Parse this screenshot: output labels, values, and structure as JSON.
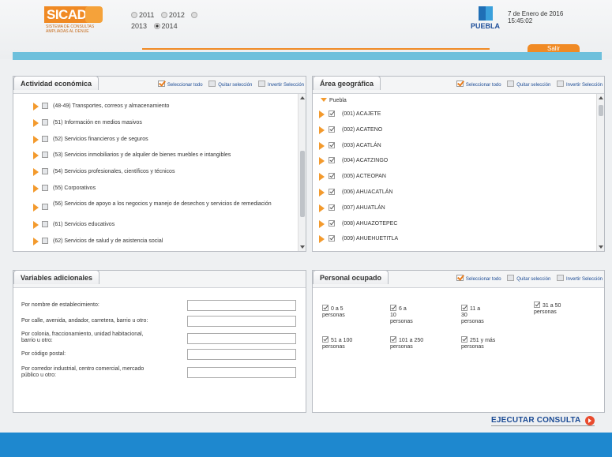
{
  "header": {
    "logo_text": "SICAD",
    "logo_subtitle": "SISTEMA DE CONSULTAS AMPLIADAS AL DENUE",
    "puebla_text": "PUEBLA",
    "date": "7 de Enero de 2016",
    "time": "15:45:02",
    "salir_label": "Salir"
  },
  "years": {
    "options": [
      "2011",
      "2012",
      "",
      "2013",
      "2014"
    ],
    "selected": "2014"
  },
  "actividad": {
    "title": "Actividad económica",
    "select_all": "Seleccionar todo",
    "clear": "Quitar selección",
    "invert": "Invertir Selección",
    "items": [
      "(48-49) Transportes, correos y almacenamiento",
      "(51) Información en medios masivos",
      "(52) Servicios financieros y de seguros",
      "(53) Servicios inmobiliarios y de alquiler de bienes muebles e intangibles",
      "(54) Servicios profesionales, científicos y técnicos",
      "(55) Corporativos",
      "(56) Servicios de apoyo a los negocios y manejo de desechos y servicios de remediación",
      "(61) Servicios educativos",
      "(62) Servicios de salud y de asistencia social"
    ]
  },
  "area": {
    "title": "Área geográfica",
    "select_all": "Seleccionar todo",
    "clear": "Quitar selección",
    "invert": "Invertir Selección",
    "root": "Puebla",
    "items": [
      "(001) ACAJETE",
      "(002) ACATENO",
      "(003) ACATLÁN",
      "(004) ACATZINGO",
      "(005) ACTEOPAN",
      "(006) AHUACATLÁN",
      "(007) AHUATLÁN",
      "(008) AHUAZOTEPEC",
      "(009) AHUEHUETITLA"
    ]
  },
  "variables": {
    "title": "Variables adicionales",
    "fields": [
      {
        "label": "Por nombre de establecimiento:",
        "value": ""
      },
      {
        "label": "Por calle, avenida, andador, carretera, barrio u otro:",
        "value": ""
      },
      {
        "label": "Por colonia, fraccionamiento, unidad habitacional, barrio u otro:",
        "value": ""
      },
      {
        "label": "Por código postal:",
        "value": ""
      },
      {
        "label": "Por corredor industrial, centro comercial, mercado público u otro:",
        "value": ""
      }
    ]
  },
  "personal": {
    "title": "Personal ocupado",
    "select_all": "Seleccionar todo",
    "clear": "Quitar selección",
    "invert": "Invertir Selección",
    "options": [
      "0 a 5 personas",
      "6 a 10 personas",
      "11 a 30 personas",
      "31 a 50 personas",
      "51 a 100 personas",
      "101 a 250 personas",
      "251 y más personas"
    ]
  },
  "actions": {
    "execute_label": "EJECUTAR CONSULTA"
  },
  "colors": {
    "accent_orange": "#f08a24",
    "top_bar_blue": "#6ec0dc",
    "footer_blue": "#1e88cf",
    "link_blue": "#1a4a94"
  }
}
